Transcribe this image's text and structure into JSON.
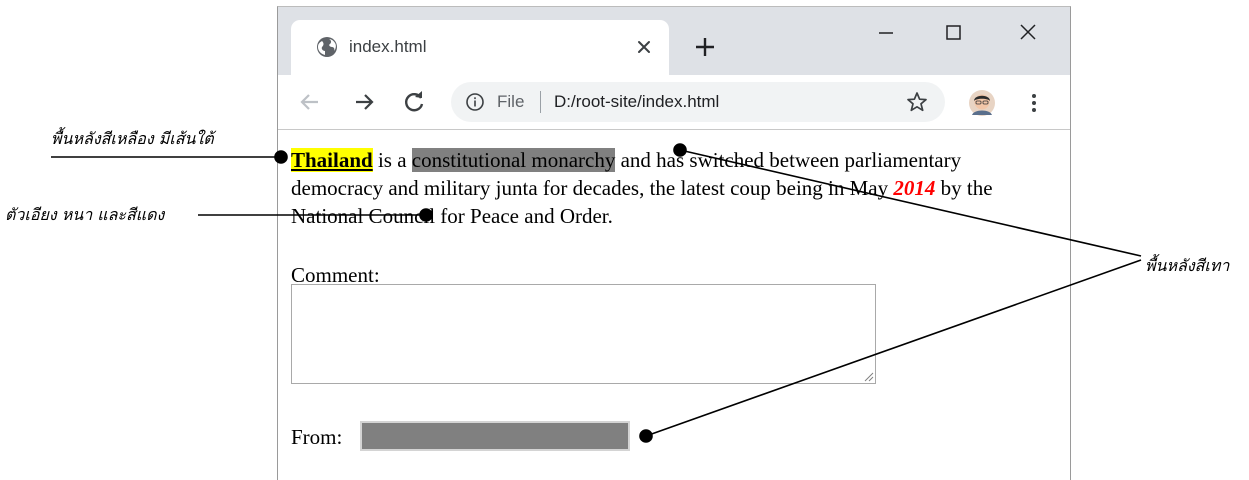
{
  "browser": {
    "tab": {
      "title": "index.html"
    },
    "address": {
      "scheme": "File",
      "url": "D:/root-site/index.html"
    },
    "icons": {
      "tab": "globe-icon",
      "close": "close-icon",
      "new_tab": "plus-icon",
      "back": "back-arrow-icon",
      "forward": "forward-arrow-icon",
      "reload": "reload-icon",
      "info": "info-icon",
      "bookmark": "star-icon",
      "profile": "avatar",
      "menu": "kebab-menu-icon",
      "minimize": "minimize-icon",
      "maximize": "maximize-icon",
      "window_close": "window-close-icon"
    }
  },
  "page": {
    "paragraph": {
      "highlight_yellow": "Thailand",
      "text1": " is a ",
      "highlight_gray": "constitutional monarchy",
      "text2": " and has switched between parliamentary democracy and military junta for decades, the latest coup being in May ",
      "red_bold_italic": "2014",
      "text3": " by the National Council for Peace and Order."
    },
    "comment_label": "Comment:",
    "comment_value": "",
    "from_label": "From:",
    "from_value": ""
  },
  "annotations": {
    "yellow_underline": "พื้นหลังสีเหลือง มีเส้นใต้",
    "italic_bold_red": "ตัวเอียง หนา และสีแดง",
    "gray_background": "พื้นหลังสีเทา"
  },
  "colors": {
    "yellow": "#ffff00",
    "gray": "#808080",
    "red": "#ff0000",
    "tabstrip": "#dee1e6",
    "omnibox": "#f1f3f4"
  }
}
